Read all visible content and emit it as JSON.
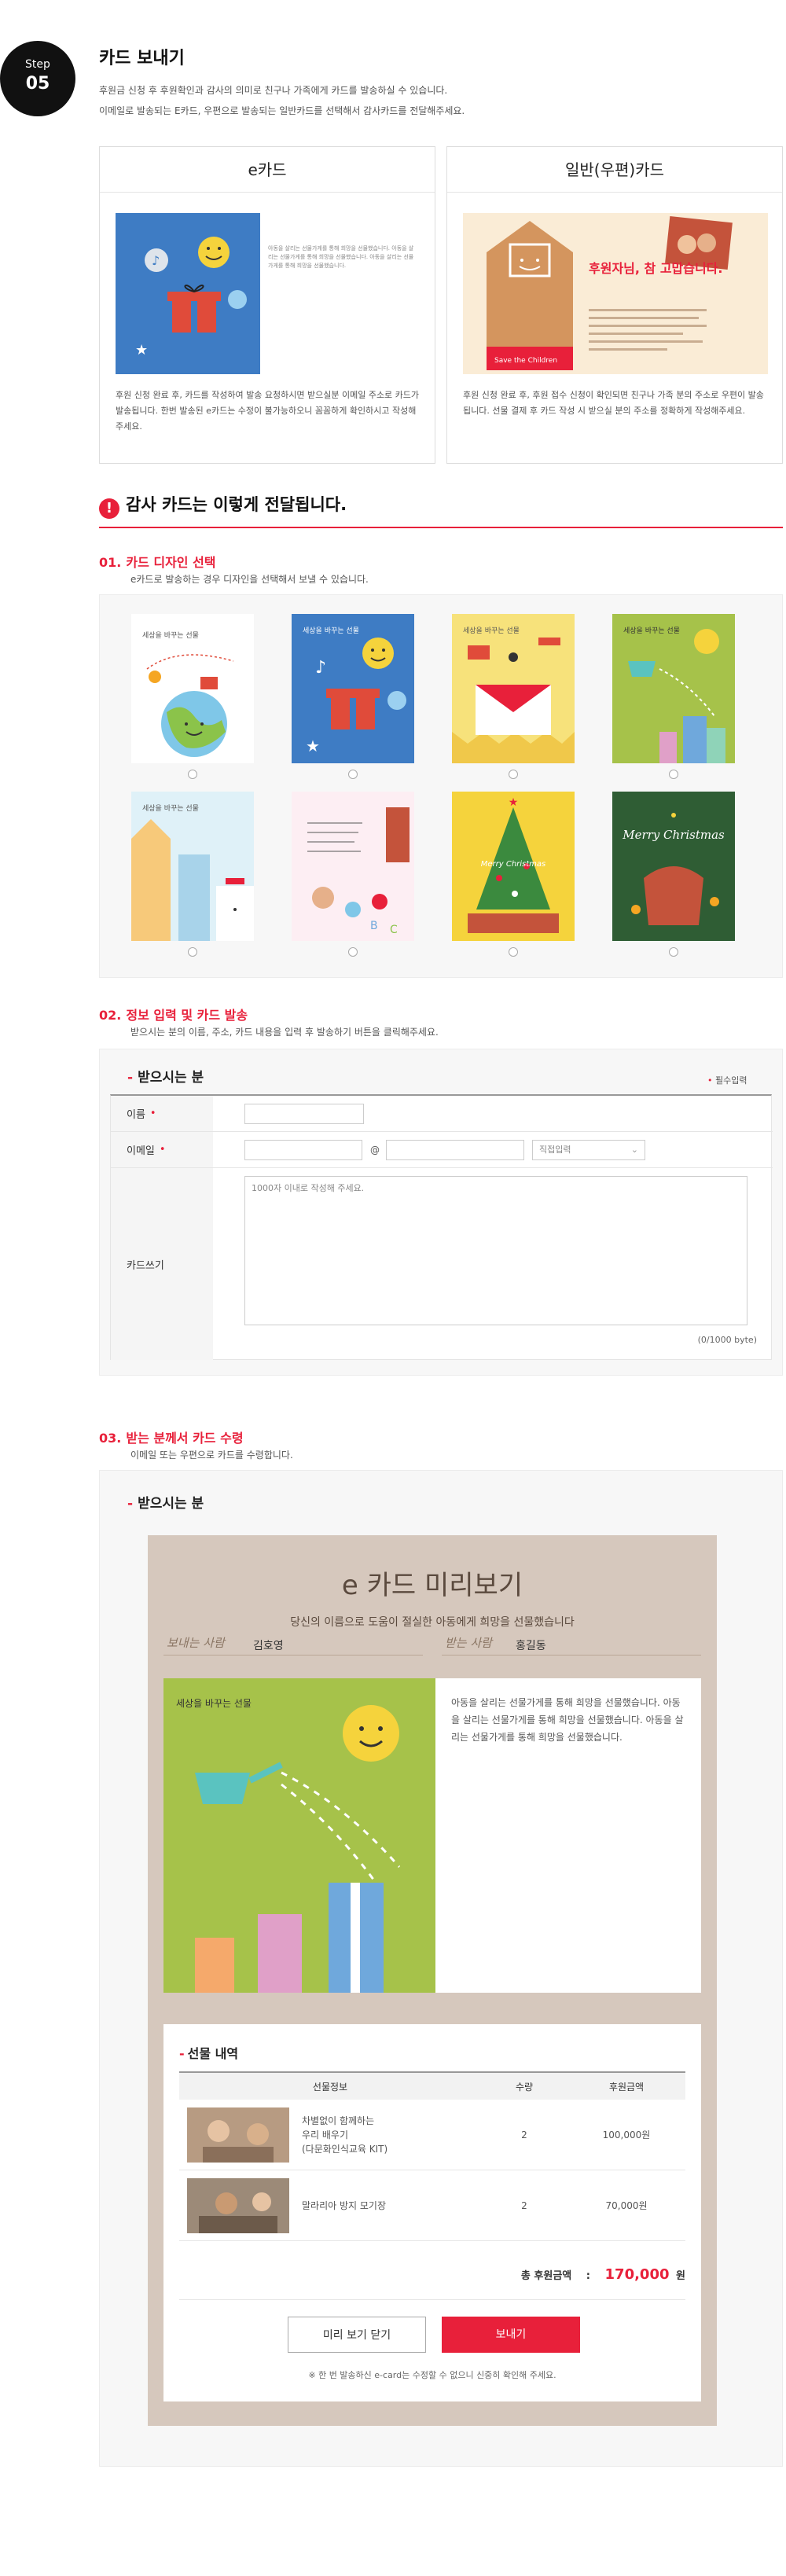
{
  "step": {
    "label": "Step",
    "number": "05"
  },
  "section": {
    "title": "카드 보내기",
    "desc_line1": "후원금 신청 후 후원확인과 감사의 의미로 친구나 가족에게 카드를 발송하실 수 있습니다.",
    "desc_line2": "이메일로 발송되는 E카드, 우편으로 발송되는 일반카드를 선택해서 감사카드를 전달해주세요."
  },
  "card_types": [
    {
      "title": "e카드",
      "mini_text": "아동을 살리는 선물가게를 통해 희망을 선물했습니다. 아동을 살리는 선물가게를 통해 희망을 선물했습니다. 아동을 살리는 선물가게를 통해 희망을 선물했습니다.",
      "desc": "후원 신청 완료 후, 카드를 작성하여 발송 요청하시면 받으실분 이메일 주소로 카드가 발송됩니다. 한번 발송된 e카드는 수정이 불가능하오니 꼼꼼하게 확인하시고 작성해주세요."
    },
    {
      "title": "일반(우편)카드",
      "mini_heading": "후원자님, 참 고맙습니다.",
      "mini_logo": "Save the Children",
      "desc": "후원 신청 완료 후, 후원 접수 신청이 확인되면 친구나 가족 분의 주소로 우편이 발송됩니다. 선물 결제 후 카드 작성 시 받으실 분의 주소를 정확하게 작성해주세요."
    }
  ],
  "notice": {
    "icon": "!",
    "text": "감사 카드는 이렇게 전달됩니다."
  },
  "steps": [
    {
      "num": "01.",
      "title": "카드 디자인 선택",
      "desc": "e카드로 발송하는 경우 디자인을 선택해서 보낼 수 있습니다."
    },
    {
      "num": "02.",
      "title": "정보 입력 및 카드 발송",
      "desc": "받으시는 분의 이름, 주소, 카드 내용을 입력 후 발송하기 버튼을 클릭해주세요."
    },
    {
      "num": "03.",
      "title": "받는 분께서 카드 수령",
      "desc": "이메일 또는 우편으로 카드를 수령합니다."
    }
  ],
  "card_mini_logo": "세상을 바꾸는 선물",
  "xmas_text": "Merry Christmas",
  "form": {
    "title": "받으시는 분",
    "required_note": "필수입력",
    "name_label": "이름",
    "email_label": "이메일",
    "at": "@",
    "domain_select": "직접입력",
    "card_label": "카드쓰기",
    "card_placeholder": "1000자 이내로 작성해 주세요.",
    "counter": "(0/1000 byte)"
  },
  "receive_title": "받으시는 분",
  "preview": {
    "title": "e 카드 미리보기",
    "subtitle": "당신의 이름으로 도움이 절실한 아동에게 희망을 선물했습니다",
    "sender_label": "보내는 사람",
    "sender_name": "김호영",
    "receiver_label": "받는 사람",
    "receiver_name": "홍길동",
    "message": "아동을 살리는 선물가게를 통해 희망을 선물했습니다. 아동을 살리는 선물가게를 통해 희망을 선물했습니다. 아동을 살리는 선물가게를 통해 희망을 선물했습니다."
  },
  "gift": {
    "title": "선물 내역",
    "headers": [
      "선물정보",
      "수량",
      "후원금액"
    ],
    "items": [
      {
        "name_line1": "차별없이 함께하는",
        "name_line2": "우리 배우기",
        "name_line3": "(다문화인식교육 KIT)",
        "qty": "2",
        "amount": "100,000원"
      },
      {
        "name_line1": "말라리아 방지 모기장",
        "name_line2": "",
        "name_line3": "",
        "qty": "2",
        "amount": "70,000원"
      }
    ],
    "total_label": "총 후원금액",
    "total_colon": ":",
    "total_amount": "170,000",
    "total_unit": "원",
    "close_button": "미리 보기 닫기",
    "send_button": "보내기",
    "footnote": "※ 한 번 발송하신 e-card는 수정할 수 없으니 신중히 확인해 주세요."
  },
  "colors": {
    "accent": "#e8203a",
    "badge": "#111111",
    "preview_bg": "#d6c8bd"
  }
}
